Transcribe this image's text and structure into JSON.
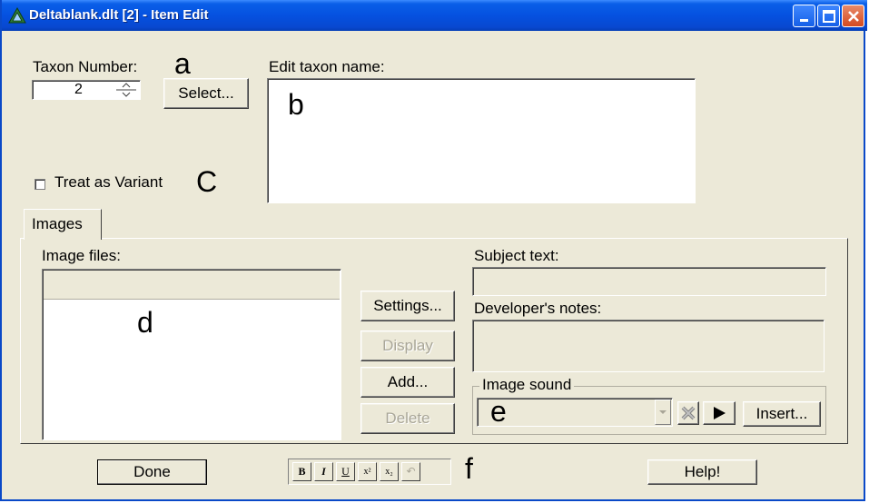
{
  "window": {
    "title": "Deltablank.dlt [2] - Item Edit",
    "title_color": "#0a5fe8"
  },
  "left_panel": {
    "taxon_number_label": "Taxon Number:",
    "taxon_number_value": "2",
    "select_button": "Select...",
    "treat_as_variant_label": "Treat as Variant",
    "treat_as_variant_checked": false
  },
  "edit_name": {
    "label": "Edit taxon name:",
    "value": ""
  },
  "tabs": [
    {
      "label": "Images",
      "active": true
    }
  ],
  "images": {
    "image_files_label": "Image files:",
    "settings_button": "Settings...",
    "display_button": "Display",
    "add_button": "Add...",
    "delete_button": "Delete",
    "subject_text_label": "Subject text:",
    "developers_notes_label": "Developer's notes:",
    "image_sound_label": "Image sound",
    "insert_button": "Insert..."
  },
  "bottom": {
    "done_button": "Done",
    "help_button": "Help!",
    "format_buttons": [
      "B",
      "I",
      "U",
      "x²",
      "x₂",
      "↶"
    ]
  },
  "annotations": {
    "a": "a",
    "b": "b",
    "c": "C",
    "d": "d",
    "e": "e",
    "f": "f"
  }
}
